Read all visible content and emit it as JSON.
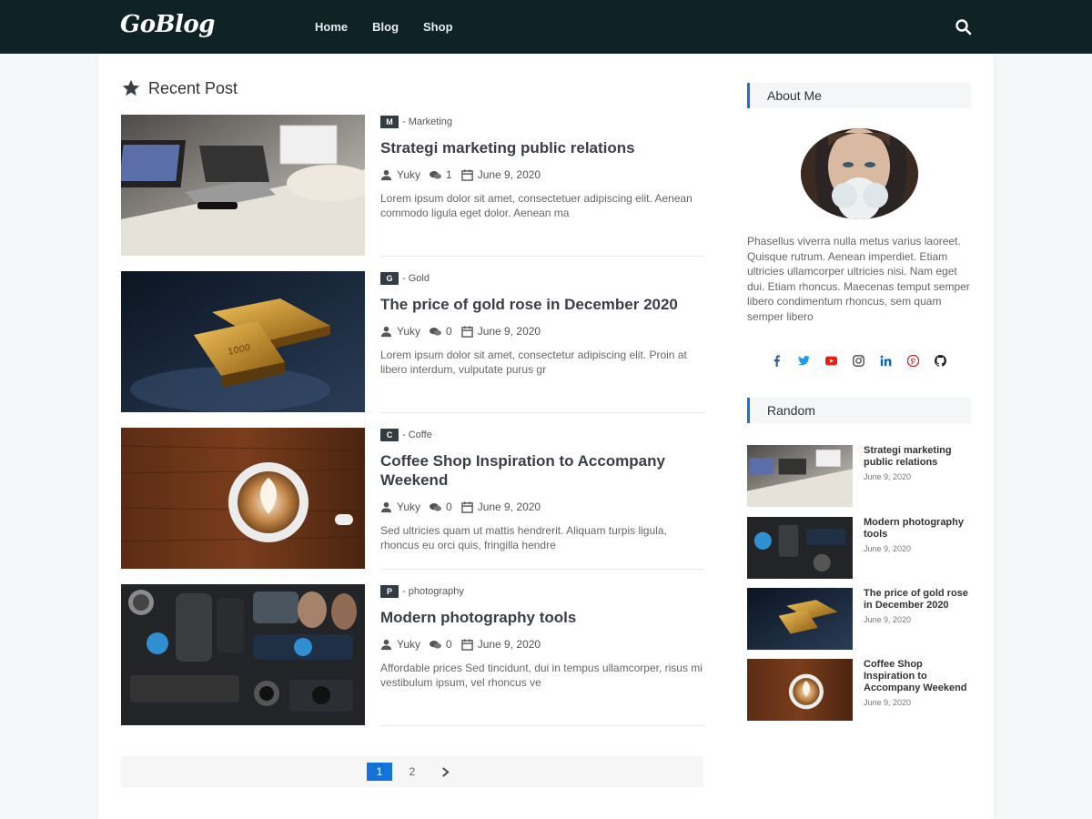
{
  "header": {
    "logo": "GoBlog",
    "nav": [
      "Home",
      "Blog",
      "Shop"
    ]
  },
  "main": {
    "title": "Recent Post",
    "posts": [
      {
        "badge": "M",
        "category": "- Marketing",
        "title": "Strategi marketing public relations",
        "author": "Yuky",
        "comments": "1",
        "date": "June 9, 2020",
        "excerpt": "Lorem ipsum dolor sit amet, consectetuer adipiscing elit. Aenean commodo ligula eget dolor. Aenean ma"
      },
      {
        "badge": "G",
        "category": "- Gold",
        "title": "The price of gold rose in December 2020",
        "author": "Yuky",
        "comments": "0",
        "date": "June 9, 2020",
        "excerpt": "Lorem ipsum dolor sit amet, consectetur adipiscing elit. Proin at libero interdum, vulputate purus gr"
      },
      {
        "badge": "C",
        "category": "- Coffe",
        "title": "Coffee Shop Inspiration to Accompany Weekend",
        "author": "Yuky",
        "comments": "0",
        "date": "June 9, 2020",
        "excerpt": "Sed ultricies quam ut mattis hendrerit. Aliquam turpis ligula, rhoncus eu orci quis, fringilla hendre"
      },
      {
        "badge": "P",
        "category": "- photography",
        "title": "Modern photography tools",
        "author": "Yuky",
        "comments": "0",
        "date": "June 9, 2020",
        "excerpt": "Affordable prices Sed tincidunt, dui in tempus ullamcorper, risus mi vestibulum ipsum, vel rhoncus ve"
      }
    ],
    "pagination": [
      "1",
      "2"
    ]
  },
  "sidebar": {
    "about_title": "About Me",
    "about_text": "Phasellus viverra nulla metus varius laoreet. Quisque rutrum. Aenean imperdiet. Etiam ultricies ullamcorper ultricies nisi. Nam eget dui. Etiam rhoncus. Maecenas temput semper libero condimentum rhoncus, sem quam semper libero",
    "socials": [
      "facebook-icon",
      "twitter-icon",
      "youtube-icon",
      "instagram-icon",
      "linkedin-icon",
      "pinterest-icon",
      "github-icon"
    ],
    "random_title": "Random",
    "random": [
      {
        "title": "Strategi marketing public relations",
        "date": "June 9, 2020"
      },
      {
        "title": "Modern photography tools",
        "date": "June 9, 2020"
      },
      {
        "title": "The price of gold rose in December 2020",
        "date": "June 9, 2020"
      },
      {
        "title": "Coffee Shop Inspiration to Accompany Weekend",
        "date": "June 9, 2020"
      }
    ]
  },
  "colors": {
    "header_bg": "#0f2226",
    "accent": "#1572d8",
    "badge_bg": "#333b44"
  }
}
